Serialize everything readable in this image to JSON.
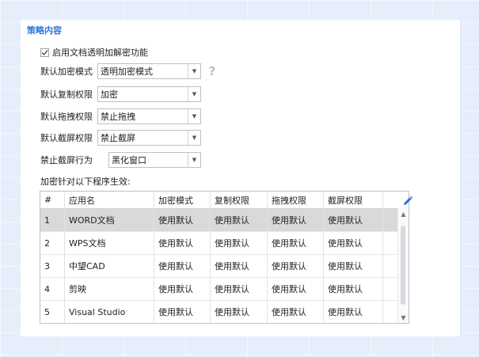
{
  "section": {
    "title": "策略内容"
  },
  "enable_checkbox": {
    "label": "启用文档透明加解密功能",
    "checked": true
  },
  "fields": [
    {
      "label": "默认加密模式",
      "value": "透明加密模式",
      "help": "?"
    },
    {
      "label": "默认复制权限",
      "value": "加密"
    },
    {
      "label": "默认拖拽权限",
      "value": "禁止拖拽"
    },
    {
      "label": "默认截屏权限",
      "value": "禁止截屏"
    },
    {
      "label": "禁止截屏行为",
      "value": "黑化窗口"
    }
  ],
  "table": {
    "caption": "加密针对以下程序生效:",
    "columns": [
      "#",
      "应用名",
      "加密模式",
      "复制权限",
      "拖拽权限",
      "截屏权限"
    ],
    "rows": [
      [
        "1",
        "WORD文档",
        "使用默认",
        "使用默认",
        "使用默认",
        "使用默认"
      ],
      [
        "2",
        "WPS文档",
        "使用默认",
        "使用默认",
        "使用默认",
        "使用默认"
      ],
      [
        "3",
        "中望CAD",
        "使用默认",
        "使用默认",
        "使用默认",
        "使用默认"
      ],
      [
        "4",
        "剪映",
        "使用默认",
        "使用默认",
        "使用默认",
        "使用默认"
      ],
      [
        "5",
        "Visual Studio",
        "使用默认",
        "使用默认",
        "使用默认",
        "使用默认"
      ]
    ],
    "selected_row": 0
  },
  "icons": {
    "edit": "pencil-icon",
    "help": "question-icon",
    "dropdown": "chevron-down-icon"
  },
  "colors": {
    "accent": "#2b78d6",
    "selected_row": "#d9d9d9"
  }
}
